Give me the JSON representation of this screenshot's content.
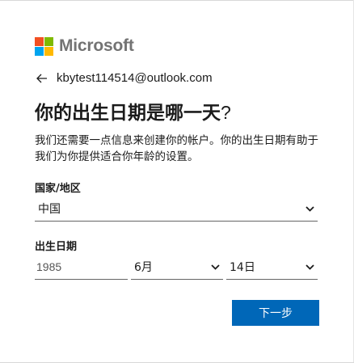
{
  "brand": {
    "name": "Microsoft",
    "colors": {
      "red": "#f25022",
      "green": "#7fba00",
      "blue": "#00a4ef",
      "yellow": "#ffb900",
      "accent": "#0067b8"
    }
  },
  "identity": {
    "back_icon": "arrow-left-icon",
    "email": "kbytest114514@outlook.com"
  },
  "title": {
    "main": "你的出生日期是哪一天",
    "question_mark": "?"
  },
  "description": "我们还需要一点信息来创建你的帐户。你的出生日期有助于我们为你提供适合你年龄的设置。",
  "country": {
    "label": "国家/地区",
    "selected": "中国",
    "icon": "chevron-down-icon"
  },
  "birthdate": {
    "label": "出生日期",
    "year": "1985",
    "month": "6月",
    "day": "14日"
  },
  "next_button": "下一步"
}
